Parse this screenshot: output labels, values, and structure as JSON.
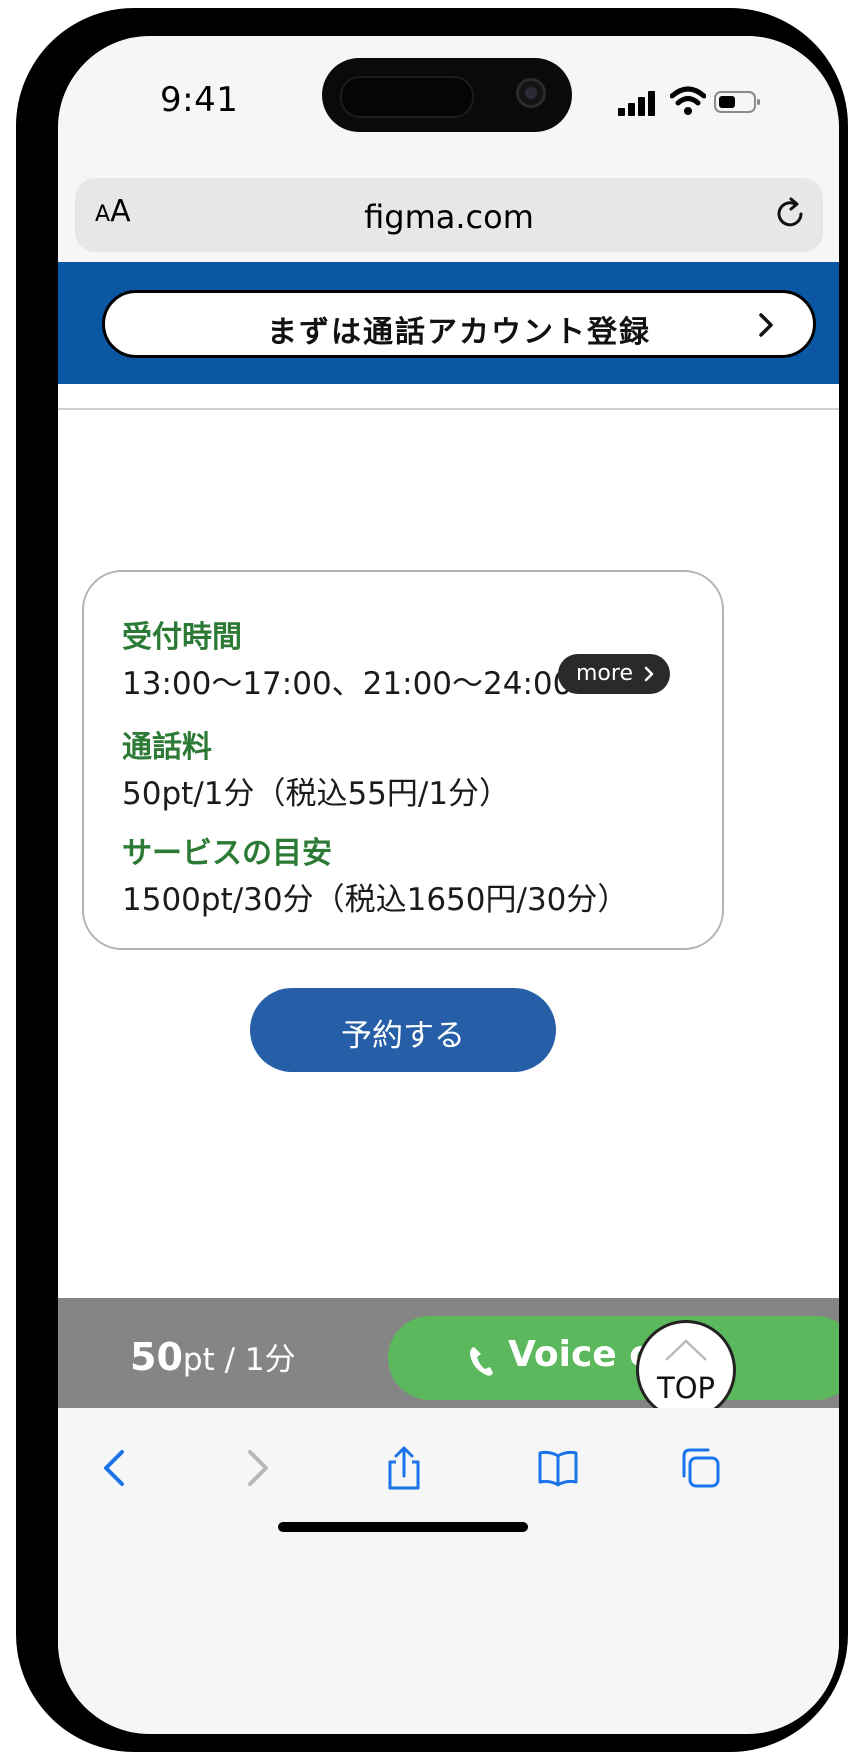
{
  "status_bar": {
    "time": "9:41"
  },
  "browser": {
    "text_size_label_small": "A",
    "text_size_label_large": "A",
    "url": "figma.com"
  },
  "banner": {
    "register_label": "まずは通話アカウント登録"
  },
  "info_card": {
    "hours_title": "受付時間",
    "hours_value": "13:00〜17:00、21:00〜24:00",
    "more_label": "more",
    "fee_title": "通話料",
    "fee_value": "50pt/1分（税込55円/1分）",
    "estimate_title": "サービスの目安",
    "estimate_value": "1500pt/30分（税込1650円/30分）"
  },
  "reserve_label": "予約する",
  "call_bar": {
    "price_amount": "50",
    "price_unit": "pt / 1分",
    "voice_label": "Voice call"
  },
  "top_button_label": "TOP",
  "colors": {
    "banner": "#0b57a4",
    "heading_green": "#2c7a36",
    "reserve_blue": "#275ea8",
    "voice_green": "#5cb85c",
    "ios_blue": "#1a73e8"
  }
}
